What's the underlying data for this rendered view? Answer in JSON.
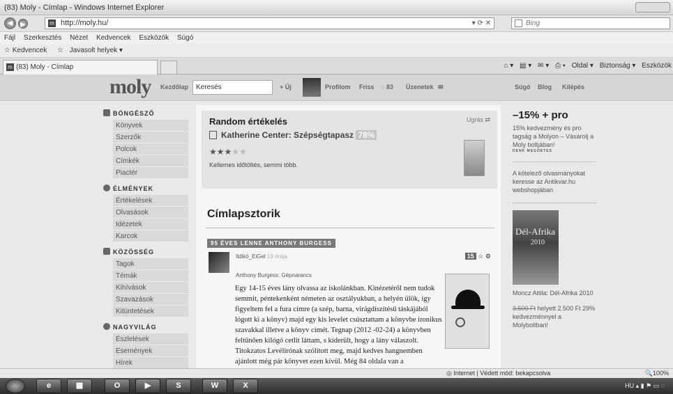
{
  "window": {
    "title": "(83) Moly - Címlap - Windows Internet Explorer"
  },
  "addr": {
    "url": "http://moly.hu/",
    "search_placeholder": "Bing"
  },
  "menu": [
    "Fájl",
    "Szerkesztés",
    "Nézet",
    "Kedvencek",
    "Eszközök",
    "Súgó"
  ],
  "favbar": {
    "favorites": "Kedvencek",
    "suggested": "Javasolt helyek ▾"
  },
  "tab": {
    "title": "(83) Moly - Címlap"
  },
  "cmdbar": {
    "page": "Oldal ▾",
    "security": "Biztonság ▾",
    "tools": "Eszközök"
  },
  "site": {
    "logo": "moly",
    "nav_home": "Kezdőlap",
    "search_value": "Keresés",
    "new": "Új",
    "profile": "Profilom",
    "fresh": "Friss",
    "fresh_count": "83",
    "messages": "Üzenetek",
    "help": "Súgó",
    "blog": "Blog",
    "logout": "Kilépés"
  },
  "sidebar": {
    "browser": {
      "title": "BÖNGÉSZŐ",
      "items": [
        "Könyvek",
        "Szerzők",
        "Polcok",
        "Címkék",
        "Piactér"
      ]
    },
    "experiences": {
      "title": "ÉLMÉNYEK",
      "items": [
        "Értékelések",
        "Olvasások",
        "Idézetek",
        "Karcok"
      ]
    },
    "community": {
      "title": "KÖZÖSSÉG",
      "items": [
        "Tagok",
        "Témák",
        "Kihívások",
        "Szavazások",
        "Kitüntetések"
      ]
    },
    "world": {
      "title": "NAGYVILÁG",
      "items": [
        "Észlelések",
        "Események",
        "Hírek"
      ]
    }
  },
  "random": {
    "title": "Random értékelés",
    "jump": "Ugrás",
    "book": "Katherine Center: Szépségtapasz",
    "percent": "78%",
    "stars_on": "★★★",
    "stars_off": "★★",
    "text": "Kellemes időtöltés, semmi több."
  },
  "stories": {
    "title": "Címlapsztorik",
    "label": "95 ÉVES LENNE ANTHONY BURGESS",
    "user": "Ildikó_EiGel",
    "time": "19 órája",
    "count": "15",
    "book": "Anthony Burgess: Gépnarancs",
    "text": "Egy 14-15 éves lány olvassa az iskolánkban. Kinézetéről nem tudok semmit, péntekenként németen az osztályukban, a helyén ülök, így figyeltem fel a fura címre (a szép, barna, virágdíszítésű táskájából lógott ki a könyv) majd egy kis levelet csúsztattam a könyvbe ironikus szavakkal illetve a könyv címét. Tegnap (2012 -02-24) a könyvben feltűnően kilógó cetlit láttam, s kiderült, hogy a lány válaszolt. Titokzatos Levélírónak szólított meg, majd kedves hangnemben ajánlott még pár könyvet ezen kívül. Még 84 oldala van a"
  },
  "right": {
    "promo_title": "–15% + pro",
    "promo_text": "15% kedvezmény és pro tagság a Molyon – Vásárolj a Moly boltjában!",
    "promo_tiny": "DENK MEGOETES",
    "ad_text": "A kötelező olvasmányokat keresse az Antikvar.hu webshopjában",
    "book_title_line1": "Dél-Afrika",
    "book_title_line2": "2010",
    "book_caption": "Moncz Attila: Dél-Afrika 2010",
    "price_old": "3.500 Ft",
    "price_text": " helyett 2.500 Ft 29% kedvezménnyel a Molyboltban!"
  },
  "status": {
    "zone": "Internet | Védett mód: bekapcsolva",
    "zoom": "100%"
  },
  "tray": {
    "lang": "HU"
  },
  "taskbar": [
    "O",
    "▶",
    "S",
    "W",
    "X"
  ]
}
